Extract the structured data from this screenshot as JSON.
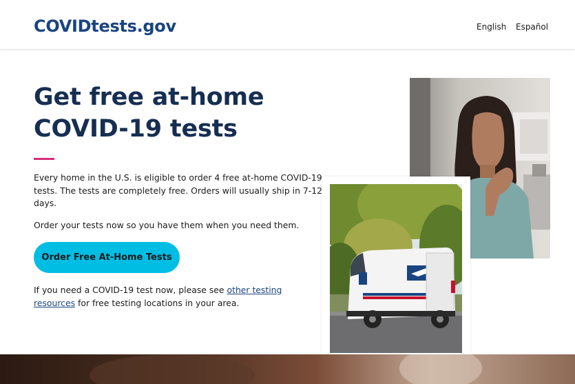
{
  "header": {
    "logo": "COVIDtests.gov",
    "lang_english": "English",
    "lang_spanish": "Español"
  },
  "hero": {
    "headline_line1": "Get free at-home",
    "headline_line2": "COVID-19 tests",
    "para1": "Every home in the U.S. is eligible to order 4 free at-home COVID-19 tests. The tests are completely free. Orders will usually ship in 7-12 days.",
    "para2": "Order your tests now so you have them when you need them.",
    "cta_label": "Order Free At-Home Tests",
    "para3_before": "If you need a COVID-19 test now, please see ",
    "para3_link": "other testing resources",
    "para3_after": " for free testing locations in your area."
  },
  "colors": {
    "brand": "#1a4480",
    "headline": "#162e51",
    "accent": "#d72d79",
    "cta_bg": "#00bde3"
  },
  "images": {
    "woman_photo": "woman-with-test-swab-photo",
    "van_photo": "usps-delivery-van-photo"
  }
}
